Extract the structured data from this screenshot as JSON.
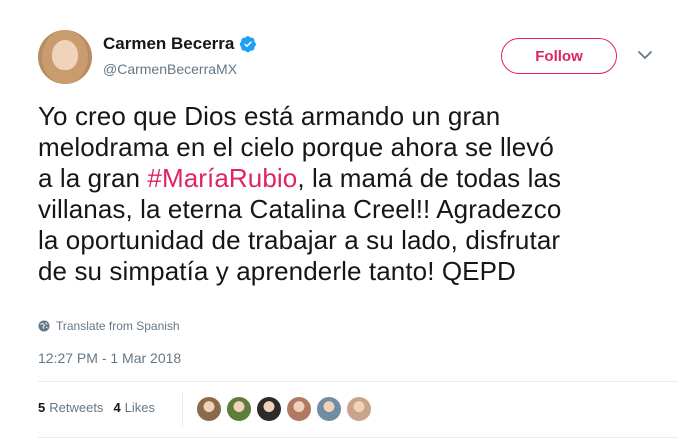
{
  "user": {
    "display_name": "Carmen Becerra",
    "handle": "@CarmenBecerraMX",
    "verified": true
  },
  "follow_label": "Follow",
  "tweet": {
    "segments": [
      "Yo creo que Dios está armando un gran",
      "melodrama en el cielo porque ahora se llevó",
      "a la gran ",
      "#MaríaRubio",
      ", la mamá de todas las",
      "villanas, la eterna Catalina Creel!! Agradezco",
      "la oportunidad de trabajar a su lado, disfrutar",
      "de su simpatía y aprenderle tanto!  QEPD"
    ]
  },
  "translate_label": "Translate from Spanish",
  "timestamp": "12:27 PM - 1 Mar 2018",
  "stats": {
    "retweets_count": "5",
    "retweets_label": "Retweets",
    "likes_count": "4",
    "likes_label": "Likes"
  },
  "colors": {
    "accent": "#e0245e",
    "verified": "#1da1f2",
    "muted_text": "#657786"
  },
  "likers": [
    {
      "color": "#8a6a4a"
    },
    {
      "color": "#5e7d3a"
    },
    {
      "color": "#2d2a28"
    },
    {
      "color": "#b07a62"
    },
    {
      "color": "#6f8da3"
    },
    {
      "color": "#c9a48a"
    }
  ]
}
